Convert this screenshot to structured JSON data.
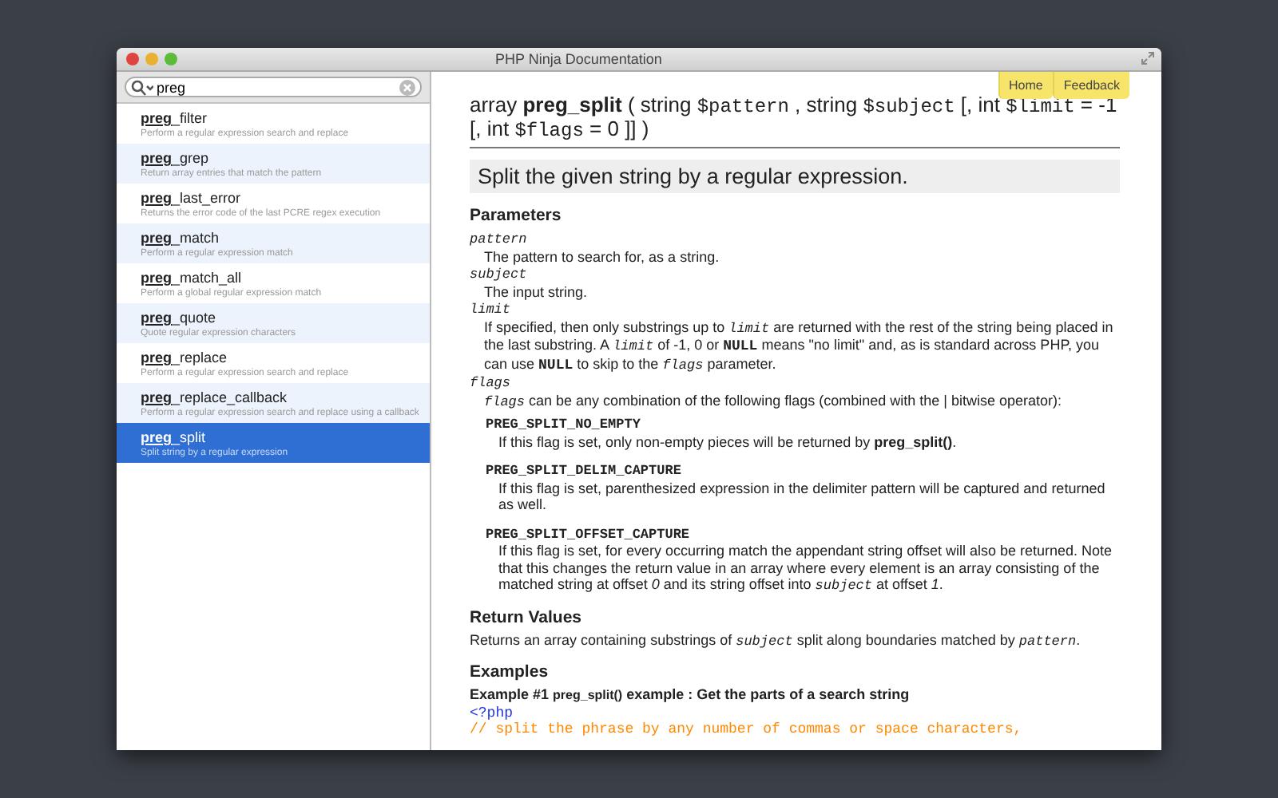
{
  "window": {
    "title": "PHP Ninja Documentation"
  },
  "search": {
    "value": "preg"
  },
  "results": [
    {
      "name": "**preg**_filter",
      "description": "Perform a regular expression search and replace",
      "selected": false
    },
    {
      "name": "**preg**_grep",
      "description": "Return array entries that match the pattern",
      "selected": false
    },
    {
      "name": "**preg**_last_error",
      "description": "Returns the error code of the last PCRE regex execution",
      "selected": false
    },
    {
      "name": "**preg**_match",
      "description": "Perform a regular expression match",
      "selected": false
    },
    {
      "name": "**preg**_match_all",
      "description": "Perform a global regular expression match",
      "selected": false
    },
    {
      "name": "**preg**_quote",
      "description": "Quote regular expression characters",
      "selected": false
    },
    {
      "name": "**preg**_replace",
      "description": "Perform a regular expression search and replace",
      "selected": false
    },
    {
      "name": "**preg**_replace_callback",
      "description": "Perform a regular expression search and replace using a callback",
      "selected": false
    },
    {
      "name": "**preg**_split",
      "description": "Split string by a regular expression",
      "selected": true
    }
  ],
  "nav_buttons": [
    "Home",
    "Feedback"
  ],
  "signature": [
    {
      "kind": "text",
      "text": "array "
    },
    {
      "kind": "bold",
      "text": "preg_split"
    },
    {
      "kind": "text",
      "text": " ( string "
    },
    {
      "kind": "code",
      "text": "$pattern"
    },
    {
      "kind": "text",
      "text": " , string "
    },
    {
      "kind": "code",
      "text": "$subject"
    },
    {
      "kind": "text",
      "text": " [, int "
    },
    {
      "kind": "code",
      "text": "$limit"
    },
    {
      "kind": "text",
      "text": " = -1 [, int "
    },
    {
      "kind": "code",
      "text": "$flags"
    },
    {
      "kind": "text",
      "text": " = 0 ]] )"
    }
  ],
  "summary": "Split the given string by a regular expression.",
  "sections": [
    {
      "heading": "Parameters",
      "blocks": [
        {
          "kind": "term",
          "runs": [
            {
              "kind": "code",
              "text": "pattern"
            }
          ]
        },
        {
          "kind": "desc",
          "runs": [
            {
              "kind": "text",
              "text": "The pattern to search for, as a string."
            }
          ]
        },
        {
          "kind": "term",
          "runs": [
            {
              "kind": "code",
              "text": "subject"
            }
          ]
        },
        {
          "kind": "desc",
          "runs": [
            {
              "kind": "text",
              "text": "The input string."
            }
          ]
        },
        {
          "kind": "term",
          "runs": [
            {
              "kind": "code",
              "text": "limit"
            }
          ]
        },
        {
          "kind": "desc",
          "runs": [
            {
              "kind": "text",
              "text": "If specified, then only substrings up to "
            },
            {
              "kind": "code",
              "text": "limit"
            },
            {
              "kind": "text",
              "text": " are returned with the rest of the string being placed in the last substring. A "
            },
            {
              "kind": "code",
              "text": "limit"
            },
            {
              "kind": "text",
              "text": " of -1, 0 or "
            },
            {
              "kind": "const",
              "text": "NULL"
            },
            {
              "kind": "text",
              "text": " means \"no limit\" and, as is standard across PHP, you can use "
            },
            {
              "kind": "const",
              "text": "NULL"
            },
            {
              "kind": "text",
              "text": " to skip to the "
            },
            {
              "kind": "code",
              "text": "flags"
            },
            {
              "kind": "text",
              "text": " parameter."
            }
          ]
        },
        {
          "kind": "term",
          "runs": [
            {
              "kind": "code",
              "text": "flags"
            }
          ]
        },
        {
          "kind": "desc",
          "runs": [
            {
              "kind": "code",
              "text": "flags"
            },
            {
              "kind": "text",
              "text": " can be any combination of the following flags (combined with the | bitwise operator):"
            }
          ]
        },
        {
          "kind": "flag",
          "runs": [
            {
              "kind": "const",
              "text": "PREG_SPLIT_NO_EMPTY"
            }
          ]
        },
        {
          "kind": "flagdesc",
          "runs": [
            {
              "kind": "text",
              "text": "If this flag is set, only non-empty pieces will be returned by "
            },
            {
              "kind": "bold",
              "text": "preg_split()"
            },
            {
              "kind": "text",
              "text": "."
            }
          ]
        },
        {
          "kind": "flag",
          "runs": [
            {
              "kind": "const",
              "text": "PREG_SPLIT_DELIM_CAPTURE"
            }
          ]
        },
        {
          "kind": "flagdesc",
          "runs": [
            {
              "kind": "text",
              "text": "If this flag is set, parenthesized expression in the delimiter pattern will be captured and returned as well."
            }
          ]
        },
        {
          "kind": "flag",
          "runs": [
            {
              "kind": "const",
              "text": "PREG_SPLIT_OFFSET_CAPTURE"
            }
          ]
        },
        {
          "kind": "flagdesc",
          "runs": [
            {
              "kind": "text",
              "text": "If this flag is set, for every occurring match the appendant string offset will also be returned. Note that this changes the return value in an array where every element is an array consisting of the matched string at offset "
            },
            {
              "kind": "em",
              "text": "0"
            },
            {
              "kind": "text",
              "text": " and its string offset into "
            },
            {
              "kind": "code",
              "text": "subject"
            },
            {
              "kind": "text",
              "text": " at offset "
            },
            {
              "kind": "em",
              "text": "1"
            },
            {
              "kind": "text",
              "text": "."
            }
          ]
        }
      ]
    },
    {
      "heading": "Return Values",
      "blocks": [
        {
          "kind": "para",
          "runs": [
            {
              "kind": "text",
              "text": "Returns an array containing substrings of "
            },
            {
              "kind": "code",
              "text": "subject"
            },
            {
              "kind": "text",
              "text": " split along boundaries matched by "
            },
            {
              "kind": "code",
              "text": "pattern"
            },
            {
              "kind": "text",
              "text": "."
            }
          ]
        }
      ]
    },
    {
      "heading": "Examples",
      "blocks": [
        {
          "kind": "example",
          "runs": [
            {
              "kind": "text",
              "text": "Example #1 "
            },
            {
              "kind": "small",
              "text": "preg_split()"
            },
            {
              "kind": "text",
              "text": " example : Get the parts of a search string"
            }
          ]
        },
        {
          "kind": "code_tag",
          "runs": [
            {
              "kind": "text",
              "text": "<?php"
            }
          ]
        },
        {
          "kind": "code_comment",
          "runs": [
            {
              "kind": "text",
              "text": "// split the phrase by any number of commas or space characters,"
            }
          ]
        }
      ]
    }
  ]
}
